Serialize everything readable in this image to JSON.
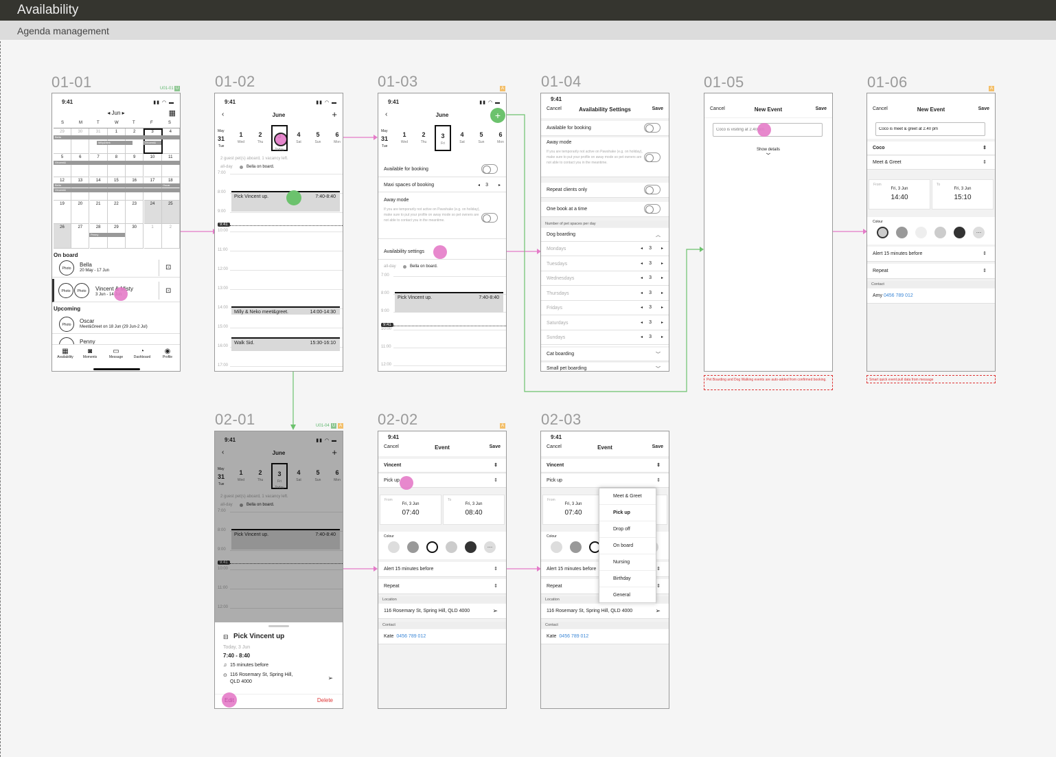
{
  "title": "Availability",
  "subtitle": "Agenda management",
  "frames": {
    "f0101": "01-01",
    "f0102": "01-02",
    "f0103": "01-03",
    "f0104": "01-04",
    "f0105": "01-05",
    "f0106": "01-06",
    "f0201": "02-01",
    "f0202": "02-02",
    "f0203": "02-03"
  },
  "tags": {
    "t1": "U01-01",
    "t2": "U01-04",
    "u": "U",
    "a": "A"
  },
  "time": "9:41",
  "month": "June",
  "f01": {
    "month": "◂ Jun ▸",
    "dow": [
      "S",
      "M",
      "T",
      "W",
      "T",
      "F",
      "S"
    ],
    "weeks": [
      [
        "29",
        "30",
        "31",
        "1",
        "2",
        "3",
        "4"
      ],
      [
        "5",
        "6",
        "7",
        "8",
        "9",
        "10",
        "11"
      ],
      [
        "12",
        "13",
        "14",
        "15",
        "16",
        "17",
        "18"
      ],
      [
        "19",
        "20",
        "21",
        "22",
        "23",
        "24",
        "25"
      ],
      [
        "26",
        "27",
        "28",
        "29",
        "30",
        "1",
        "2"
      ]
    ],
    "onboard": "On board",
    "bella": "Bella",
    "bella_d": "20 May - 17 Jun",
    "vm": "Vincent & Misty",
    "vm_d": "3 Jun - 14 Jun",
    "upcoming": "Upcoming",
    "oscar": "Oscar",
    "oscar_d": "Meet&Greet on 18 Jun (29 Jun-2 Jul)",
    "penny": "Penny",
    "photo": "Photo",
    "nav": [
      "Availability",
      "Moments",
      "Message",
      "Dashboard",
      "Profile"
    ],
    "chips": {
      "bella": "Bella",
      "milly": "Milly&Nek",
      "vincent": "Vincent&",
      "vincent2": "Vincent&",
      "bella2": "Bella",
      "vincent3": "Vincent&",
      "oscar": "Oscar",
      "penny": "Penny",
      "other": "Other"
    }
  },
  "strip": {
    "may": "May",
    "d31": "31",
    "tue": "Tue",
    "days": [
      [
        "1",
        "Wed"
      ],
      [
        "2",
        "Thu"
      ],
      [
        "3",
        "Fri"
      ],
      [
        "4",
        "Sat"
      ],
      [
        "5",
        "Sun"
      ],
      [
        "6",
        "Mon"
      ]
    ],
    "today": "Today"
  },
  "agenda": {
    "info": "2 guest pet(s) aboard, 1 vacancy left.",
    "allday": "all-day",
    "bella": "Bella on board.",
    "hours": [
      "7:00",
      "8:00",
      "9:00",
      "10:00",
      "11:00",
      "12:00",
      "13:00",
      "14:00",
      "15:00",
      "16:00",
      "17:00"
    ],
    "e1": "Pick Vincent up.",
    "e1t": "7:40-8:40",
    "e2": "Milly & Neko meet&greet.",
    "e2t": "14:00-14:30",
    "e3": "Walk Sid.",
    "e3t": "15:30-16:10",
    "now": "9:41"
  },
  "f03": {
    "avail": "Available for booking",
    "maxi": "Maxi spaces of booking",
    "maxv": "3",
    "away": "Away mode",
    "awaytxt": "If you are temporarily not active on Pawshake (e.g. on holiday), make sure to put your profile on away mode so pet owners are not able to contact you in the meantime.",
    "settings": "Availability settings"
  },
  "f04": {
    "cancel": "Cancel",
    "title": "Availability Settings",
    "save": "Save",
    "avail": "Available for booking",
    "away": "Away mode",
    "awaytxt": "If you are temporarily not active on Pawshake (e.g. on holiday), make sure to put your profile on away mode so pet owners are not able to contact you in the meantime.",
    "repeat": "Repeat clients only",
    "onebook": "One book at a time",
    "numsect": "Number of pet spaces per day",
    "dog": "Dog boarding",
    "days": [
      "Mondays",
      "Tuesdays",
      "Wednesdays",
      "Thursdays",
      "Fridays",
      "Saturdays",
      "Sundays"
    ],
    "val": "3",
    "cat": "Cat boarding",
    "small": "Small pet boarding"
  },
  "f05": {
    "cancel": "Cancel",
    "title": "New Event",
    "save": "Save",
    "placeholder": "Coco is visiting at 2.40 pm",
    "show": "Show details",
    "note": "Pet Boarding and Dog Walking events are auto-added from confirmed booking."
  },
  "f06": {
    "cancel": "Cancel",
    "title": "New Event",
    "save": "Save",
    "input": "Coco is meet & greet at 2.40 pm",
    "pet": "Coco",
    "type": "Meet & Greet",
    "from": "From",
    "to": "To",
    "fromd": "Fri, 3 Jun",
    "fromh": "14:40",
    "tod": "Fri, 3 Jun",
    "toh": "15:10",
    "colour": "Colour",
    "alert": "Alert 15 minutes before",
    "repeat": "Repeat",
    "contact": "Contact",
    "cname": "Amy",
    "cphone": "0456 789 012",
    "note": "Smart quick event pull data from message"
  },
  "f0201": {
    "title": "Pick Vincent up",
    "date": "Today, 3 Jun",
    "time": "7:40 - 8:40",
    "alert": "15 minutes before",
    "addr1": "116 Rosemary St, Spring Hill,",
    "addr2": "QLD 4000",
    "edit": "Edit",
    "delete": "Delete"
  },
  "ev": {
    "cancel": "Cancel",
    "title": "Event",
    "save": "Save",
    "pet": "Vincent",
    "type": "Pick up",
    "from": "From",
    "to": "To",
    "fromd": "Fri, 3 Jun",
    "fromh": "07:40",
    "tod": "Fri, 3 Jun",
    "toh": "08:40",
    "colour": "Colour",
    "alert": "Alert 15 minutes before",
    "repeat": "Repeat",
    "location": "Location",
    "addr": "116 Rosemary St, Spring Hill, QLD 4000",
    "contact": "Contact",
    "cname": "Kate",
    "cphone": "0456 789 012"
  },
  "menu": [
    "Meet & Greet",
    "Pick up",
    "Drop off",
    "On board",
    "Nursing",
    "Birthday",
    "General"
  ],
  "colors": {
    "accent_pink": "#e47bc8",
    "accent_green": "#6cc26d",
    "topbar": "#35352f",
    "link": "#3a86d6"
  }
}
